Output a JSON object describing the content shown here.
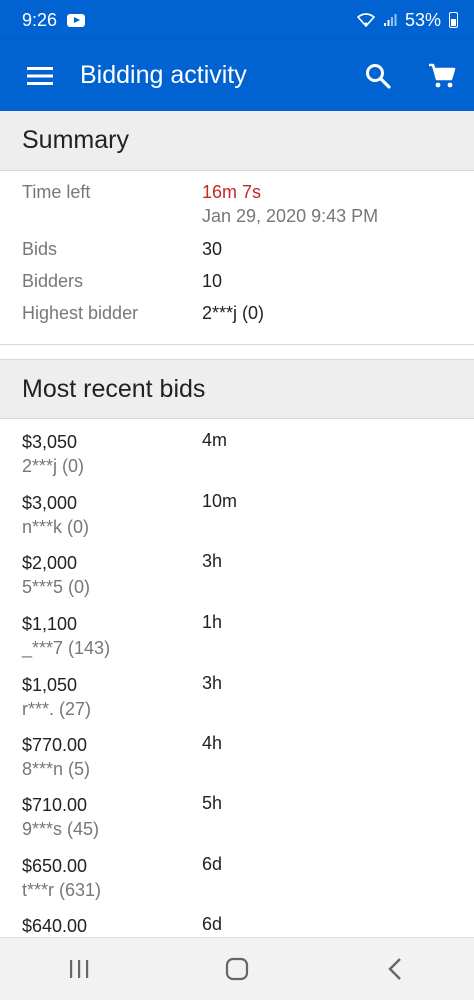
{
  "status_bar": {
    "time": "9:26",
    "battery": "53%",
    "icons": [
      "youtube-icon",
      "wifi-icon",
      "signal-icon",
      "battery-icon"
    ]
  },
  "app_bar": {
    "title": "Bidding activity",
    "icons": [
      "menu-icon",
      "search-icon",
      "cart-icon"
    ]
  },
  "summary": {
    "header": "Summary",
    "time_left_label": "Time left",
    "time_left_value": "16m 7s",
    "end_date": "Jan 29, 2020 9:43 PM",
    "bids_label": "Bids",
    "bids_value": "30",
    "bidders_label": "Bidders",
    "bidders_value": "10",
    "highest_label": "Highest bidder",
    "highest_value": "2***j (0)"
  },
  "recent": {
    "header": "Most recent bids",
    "bids": [
      {
        "amount": "$3,050",
        "user": "2***j (0)",
        "time": "4m"
      },
      {
        "amount": "$3,000",
        "user": "n***k (0)",
        "time": "10m"
      },
      {
        "amount": "$2,000",
        "user": "5***5 (0)",
        "time": "3h"
      },
      {
        "amount": "$1,100",
        "user": "_***7 (143)",
        "time": "1h"
      },
      {
        "amount": "$1,050",
        "user": "r***. (27)",
        "time": "3h"
      },
      {
        "amount": "$770.00",
        "user": "8***n (5)",
        "time": "4h"
      },
      {
        "amount": "$710.00",
        "user": "9***s (45)",
        "time": "5h"
      },
      {
        "amount": "$650.00",
        "user": "t***r (631)",
        "time": "6d"
      },
      {
        "amount": "$640.00",
        "user": "",
        "time": "6d"
      }
    ]
  },
  "colors": {
    "brand": "#0063d1",
    "time_left": "#c62828"
  }
}
